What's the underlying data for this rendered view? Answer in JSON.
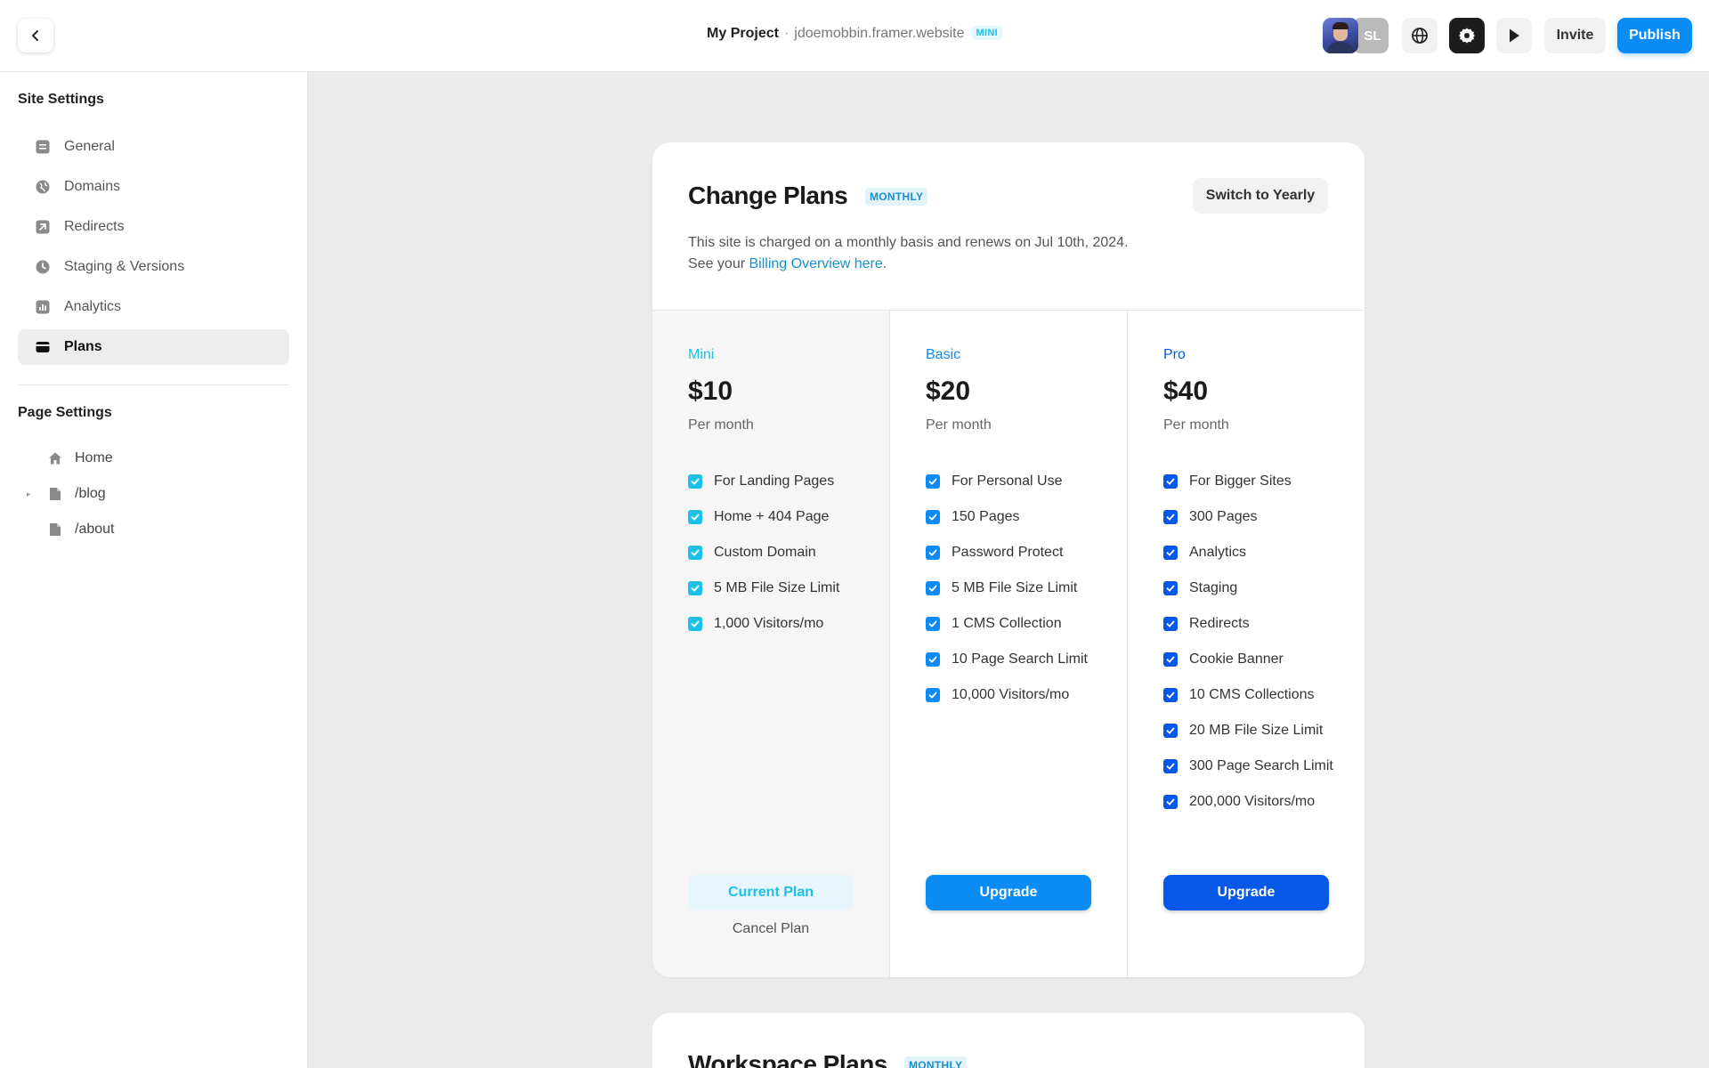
{
  "topbar": {
    "project_name": "My Project",
    "separator": "·",
    "domain": "jdoemobbin.framer.website",
    "plan_badge": "MINI",
    "avatar_initials": "SL",
    "invite_label": "Invite",
    "publish_label": "Publish"
  },
  "sidebar": {
    "site_settings_title": "Site Settings",
    "site_items": [
      {
        "label": "General",
        "icon": "general-icon"
      },
      {
        "label": "Domains",
        "icon": "globe-icon"
      },
      {
        "label": "Redirects",
        "icon": "redirect-arrow-icon"
      },
      {
        "label": "Staging & Versions",
        "icon": "clock-icon"
      },
      {
        "label": "Analytics",
        "icon": "bar-chart-icon"
      },
      {
        "label": "Plans",
        "icon": "credit-card-icon"
      }
    ],
    "active_item": "Plans",
    "page_settings_title": "Page Settings",
    "pages": [
      {
        "label": "Home",
        "icon": "home-icon"
      },
      {
        "label": "/blog",
        "icon": "page-icon"
      },
      {
        "label": "/about",
        "icon": "page-icon"
      }
    ]
  },
  "plans_card": {
    "title": "Change Plans",
    "badge": "MONTHLY",
    "switch_label": "Switch to Yearly",
    "desc_line1": "This site is charged on a monthly basis and renews on Jul 10th, 2024.",
    "desc_prefix": "See your ",
    "desc_link": "Billing Overview here",
    "desc_suffix": ".",
    "plans": [
      {
        "name": "Mini",
        "price": "$10",
        "period": "Per month",
        "color": "#1ec0e8",
        "features": [
          "For Landing Pages",
          "Home + 404 Page",
          "Custom Domain",
          "5 MB File Size Limit",
          "1,000 Visitors/mo"
        ],
        "button": "Current Plan",
        "secondary": "Cancel Plan"
      },
      {
        "name": "Basic",
        "price": "$20",
        "period": "Per month",
        "color": "#0b8cf5",
        "features": [
          "For Personal Use",
          "150 Pages",
          "Password Protect",
          "5 MB File Size Limit",
          "1 CMS Collection",
          "10 Page Search Limit",
          "10,000 Visitors/mo"
        ],
        "button": "Upgrade"
      },
      {
        "name": "Pro",
        "price": "$40",
        "period": "Per month",
        "color": "#0659e8",
        "features": [
          "For Bigger Sites",
          "300 Pages",
          "Analytics",
          "Staging",
          "Redirects",
          "Cookie Banner",
          "10 CMS Collections",
          "20 MB File Size Limit",
          "300 Page Search Limit",
          "200,000 Visitors/mo"
        ],
        "button": "Upgrade"
      }
    ]
  },
  "workspace_card": {
    "title": "Workspace Plans",
    "badge": "MONTHLY"
  }
}
